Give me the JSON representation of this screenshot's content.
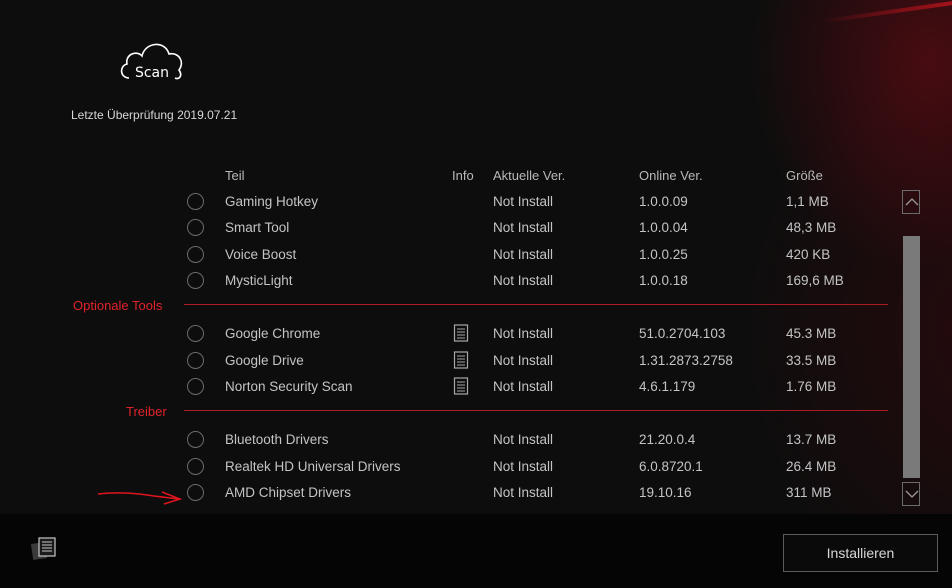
{
  "logo": {
    "text": "Scan"
  },
  "last_check": "Letzte Überprüfung 2019.07.21",
  "columns": {
    "part": "Teil",
    "info": "Info",
    "current": "Aktuelle Ver.",
    "online": "Online Ver.",
    "size": "Größe"
  },
  "items": [
    {
      "name": "Gaming Hotkey",
      "current": "Not Install",
      "online": "1.0.0.09",
      "size": "1,1 MB",
      "has_info": false
    },
    {
      "name": "Smart Tool",
      "current": "Not Install",
      "online": "1.0.0.04",
      "size": "48,3 MB",
      "has_info": false
    },
    {
      "name": "Voice Boost",
      "current": "Not Install",
      "online": "1.0.0.25",
      "size": "420 KB",
      "has_info": false
    },
    {
      "name": "MysticLight",
      "current": "Not Install",
      "online": "1.0.0.18",
      "size": "169,6 MB",
      "has_info": false
    }
  ],
  "sections": {
    "optional": {
      "label": "Optionale Tools",
      "items": [
        {
          "name": "Google Chrome",
          "current": "Not Install",
          "online": "51.0.2704.103",
          "size": "45.3 MB",
          "has_info": true
        },
        {
          "name": "Google Drive",
          "current": "Not Install",
          "online": "1.31.2873.2758",
          "size": "33.5 MB",
          "has_info": true
        },
        {
          "name": "Norton Security Scan",
          "current": "Not Install",
          "online": "4.6.1.179",
          "size": "1.76 MB",
          "has_info": true
        }
      ]
    },
    "drivers": {
      "label": "Treiber",
      "items": [
        {
          "name": "Bluetooth Drivers",
          "current": "Not Install",
          "online": "21.20.0.4",
          "size": "13.7 MB",
          "has_info": false
        },
        {
          "name": "Realtek HD Universal Drivers",
          "current": "Not Install",
          "online": "6.0.8720.1",
          "size": "26.4 MB",
          "has_info": false
        },
        {
          "name": "AMD Chipset Drivers",
          "current": "Not Install",
          "online": "19.10.16",
          "size": "311 MB",
          "has_info": false
        }
      ]
    }
  },
  "install_button": "Installieren",
  "colors": {
    "accent": "#e0232b",
    "divider": "#b01a22",
    "background": "#0d0d0d"
  },
  "icons": {
    "logo": "cloud-icon",
    "info": "document-icon",
    "footer": "log-icon",
    "scroll_up": "chevron-up-icon",
    "scroll_down": "chevron-down-icon"
  }
}
